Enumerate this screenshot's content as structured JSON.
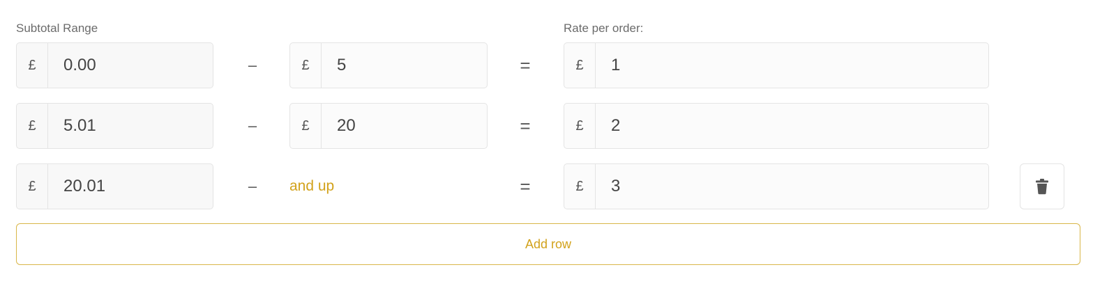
{
  "labels": {
    "subtotal_range": "Subtotal Range",
    "rate_per_order": "Rate per order:"
  },
  "currency_symbol": "£",
  "separators": {
    "dash": "–",
    "equals": "="
  },
  "rows": [
    {
      "from": "0.00",
      "to": "5",
      "rate": "1"
    },
    {
      "from": "5.01",
      "to": "20",
      "rate": "2"
    },
    {
      "from": "20.01",
      "to_text": "and up",
      "rate": "3"
    }
  ],
  "icons": {
    "delete": "trash-icon"
  },
  "add_row_label": "Add row",
  "colors": {
    "accent": "#d2a21b",
    "border": "#e4e4e4"
  }
}
